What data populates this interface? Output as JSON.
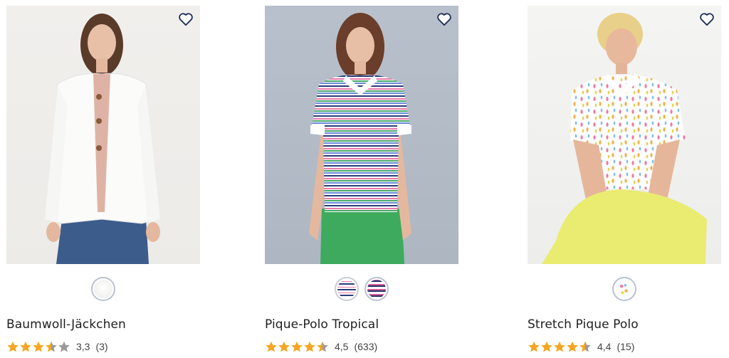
{
  "products": [
    {
      "name": "Baumwoll-Jäckchen",
      "score": "3,3",
      "count": "(3)",
      "rating": 3.3,
      "swatches": [
        "white"
      ]
    },
    {
      "name": "Pique-Polo Tropical",
      "score": "4,5",
      "count": "(633)",
      "rating": 4.5,
      "swatches": [
        "white-navy-stripe",
        "navy-pink-stripe"
      ]
    },
    {
      "name": "Stretch Pique Polo",
      "score": "4,4",
      "count": "(15)",
      "rating": 4.4,
      "swatches": [
        "white-print"
      ]
    }
  ],
  "icons": {
    "wishlist": "heart-outline-icon",
    "star_full": "star-full-icon",
    "star_empty": "star-empty-icon"
  },
  "colors": {
    "star_on": "#f5a623",
    "star_off": "#9a9a9a",
    "heart": "#1f2f5a"
  }
}
